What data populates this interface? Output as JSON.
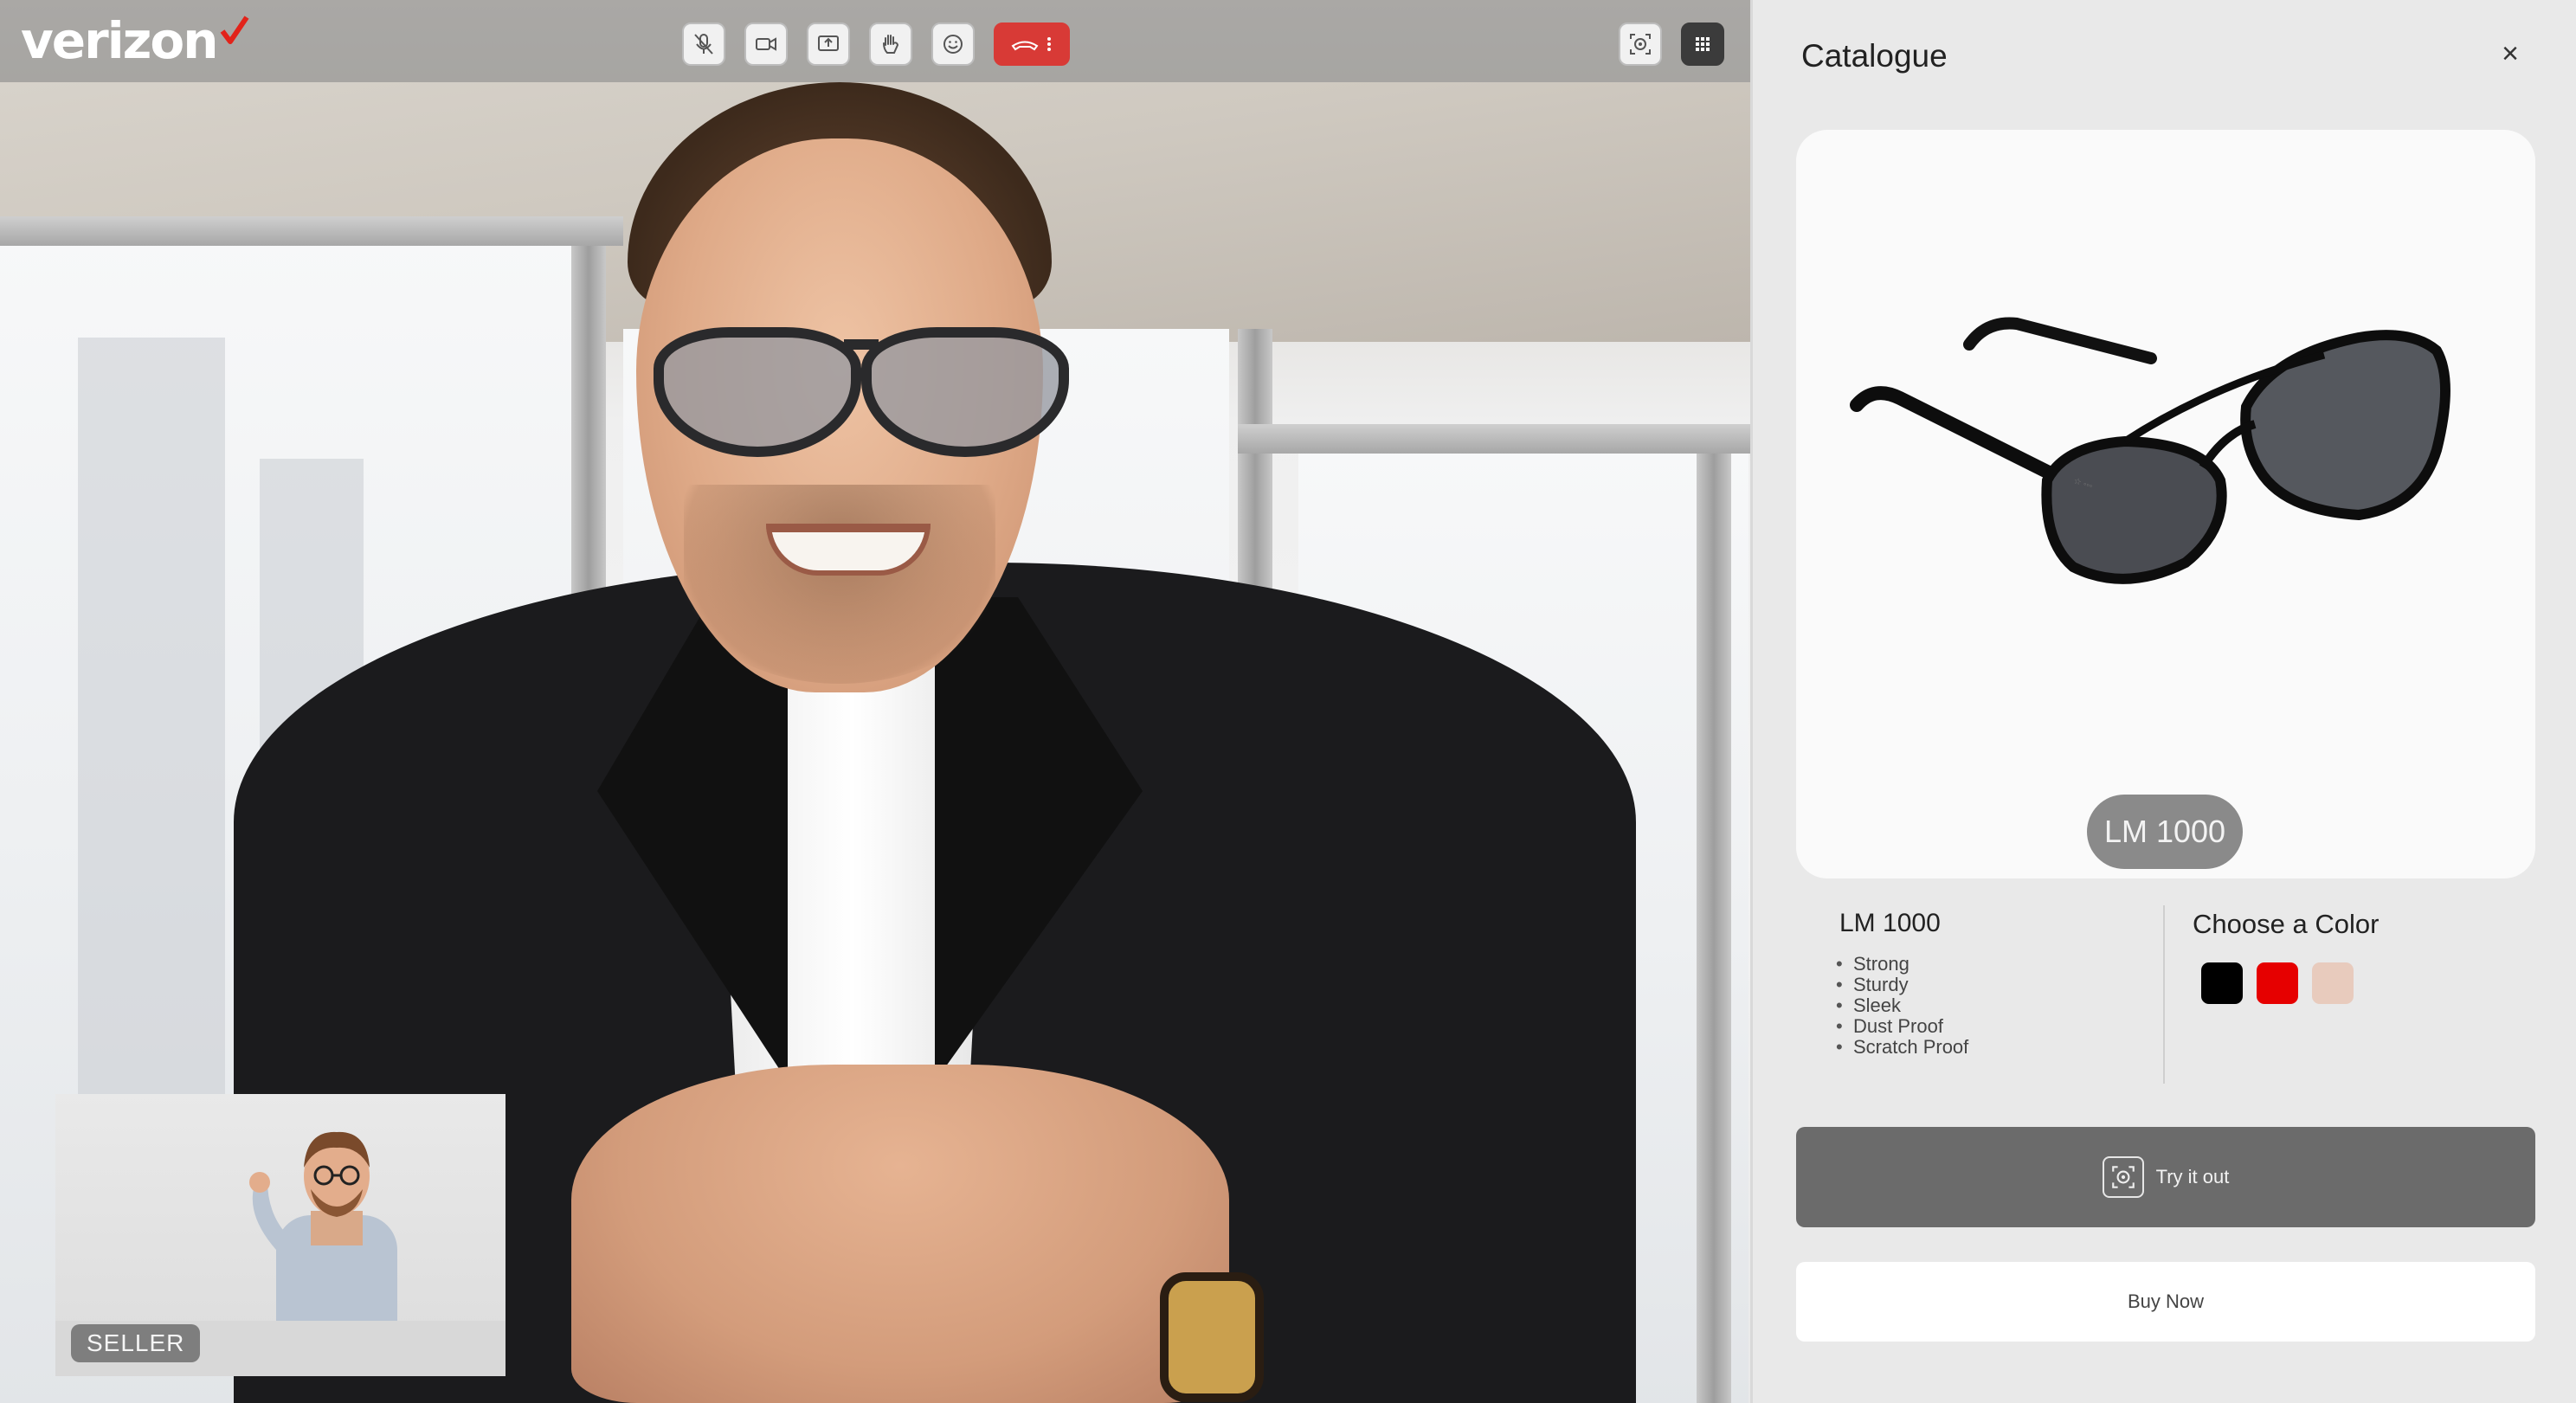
{
  "app": {
    "brand": "verizon"
  },
  "call": {
    "controls": [
      {
        "name": "mute-mic-button",
        "icon": "mic-off-icon"
      },
      {
        "name": "camera-button",
        "icon": "video-camera-icon"
      },
      {
        "name": "share-screen-button",
        "icon": "screen-share-icon"
      },
      {
        "name": "raise-hand-button",
        "icon": "hand-icon"
      },
      {
        "name": "reactions-button",
        "icon": "smiley-icon"
      },
      {
        "name": "end-call-button",
        "icon": "phone-hangup-icon"
      }
    ],
    "right_controls": [
      {
        "name": "ar-tryon-button",
        "icon": "ar-scan-icon"
      },
      {
        "name": "apps-grid-button",
        "icon": "grid-icon"
      }
    ],
    "self_view": {
      "label": "SELLER"
    }
  },
  "catalogue": {
    "title": "Catalogue",
    "close": "×",
    "product": {
      "model": "LM 1000",
      "name": "LM 1000",
      "features": [
        "Strong",
        "Sturdy",
        "Sleek",
        "Dust Proof",
        "Scratch Proof"
      ]
    },
    "color_picker": {
      "title": "Choose a Color",
      "colors": [
        "#000000",
        "#e60000",
        "#e8cbbd"
      ]
    },
    "try_button": "Try it out",
    "buy_button": "Buy Now"
  },
  "colors": {
    "end_call": "#d83a36",
    "panel_bg": "#e9e9e9",
    "primary_button": "#6b6b6b"
  }
}
